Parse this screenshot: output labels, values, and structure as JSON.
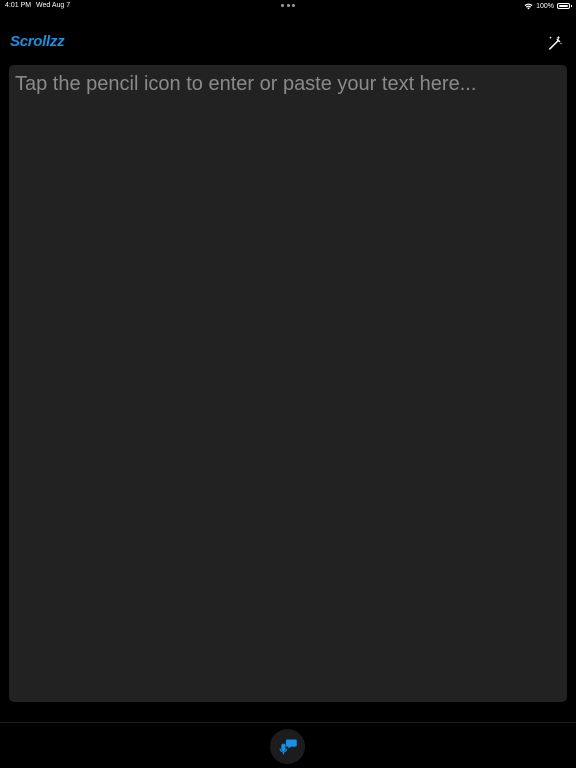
{
  "status_bar": {
    "time": "4:01 PM",
    "date": "Wed Aug 7",
    "battery": "100%",
    "wifi_icon": "wifi-icon",
    "battery_icon": "battery-icon",
    "multitask_icon": "ellipsis-icon"
  },
  "nav": {
    "title": "Scrollzz",
    "magic_icon": "magic-wand-icon"
  },
  "editor": {
    "placeholder": "Tap the pencil icon to enter or paste your text here..."
  },
  "bottom_bar": {
    "voice_icon": "voice-chat-icon"
  },
  "colors": {
    "accent": "#1a8fe3",
    "background": "#000000",
    "editor_background": "#222222",
    "placeholder": "#8a8a8a"
  }
}
